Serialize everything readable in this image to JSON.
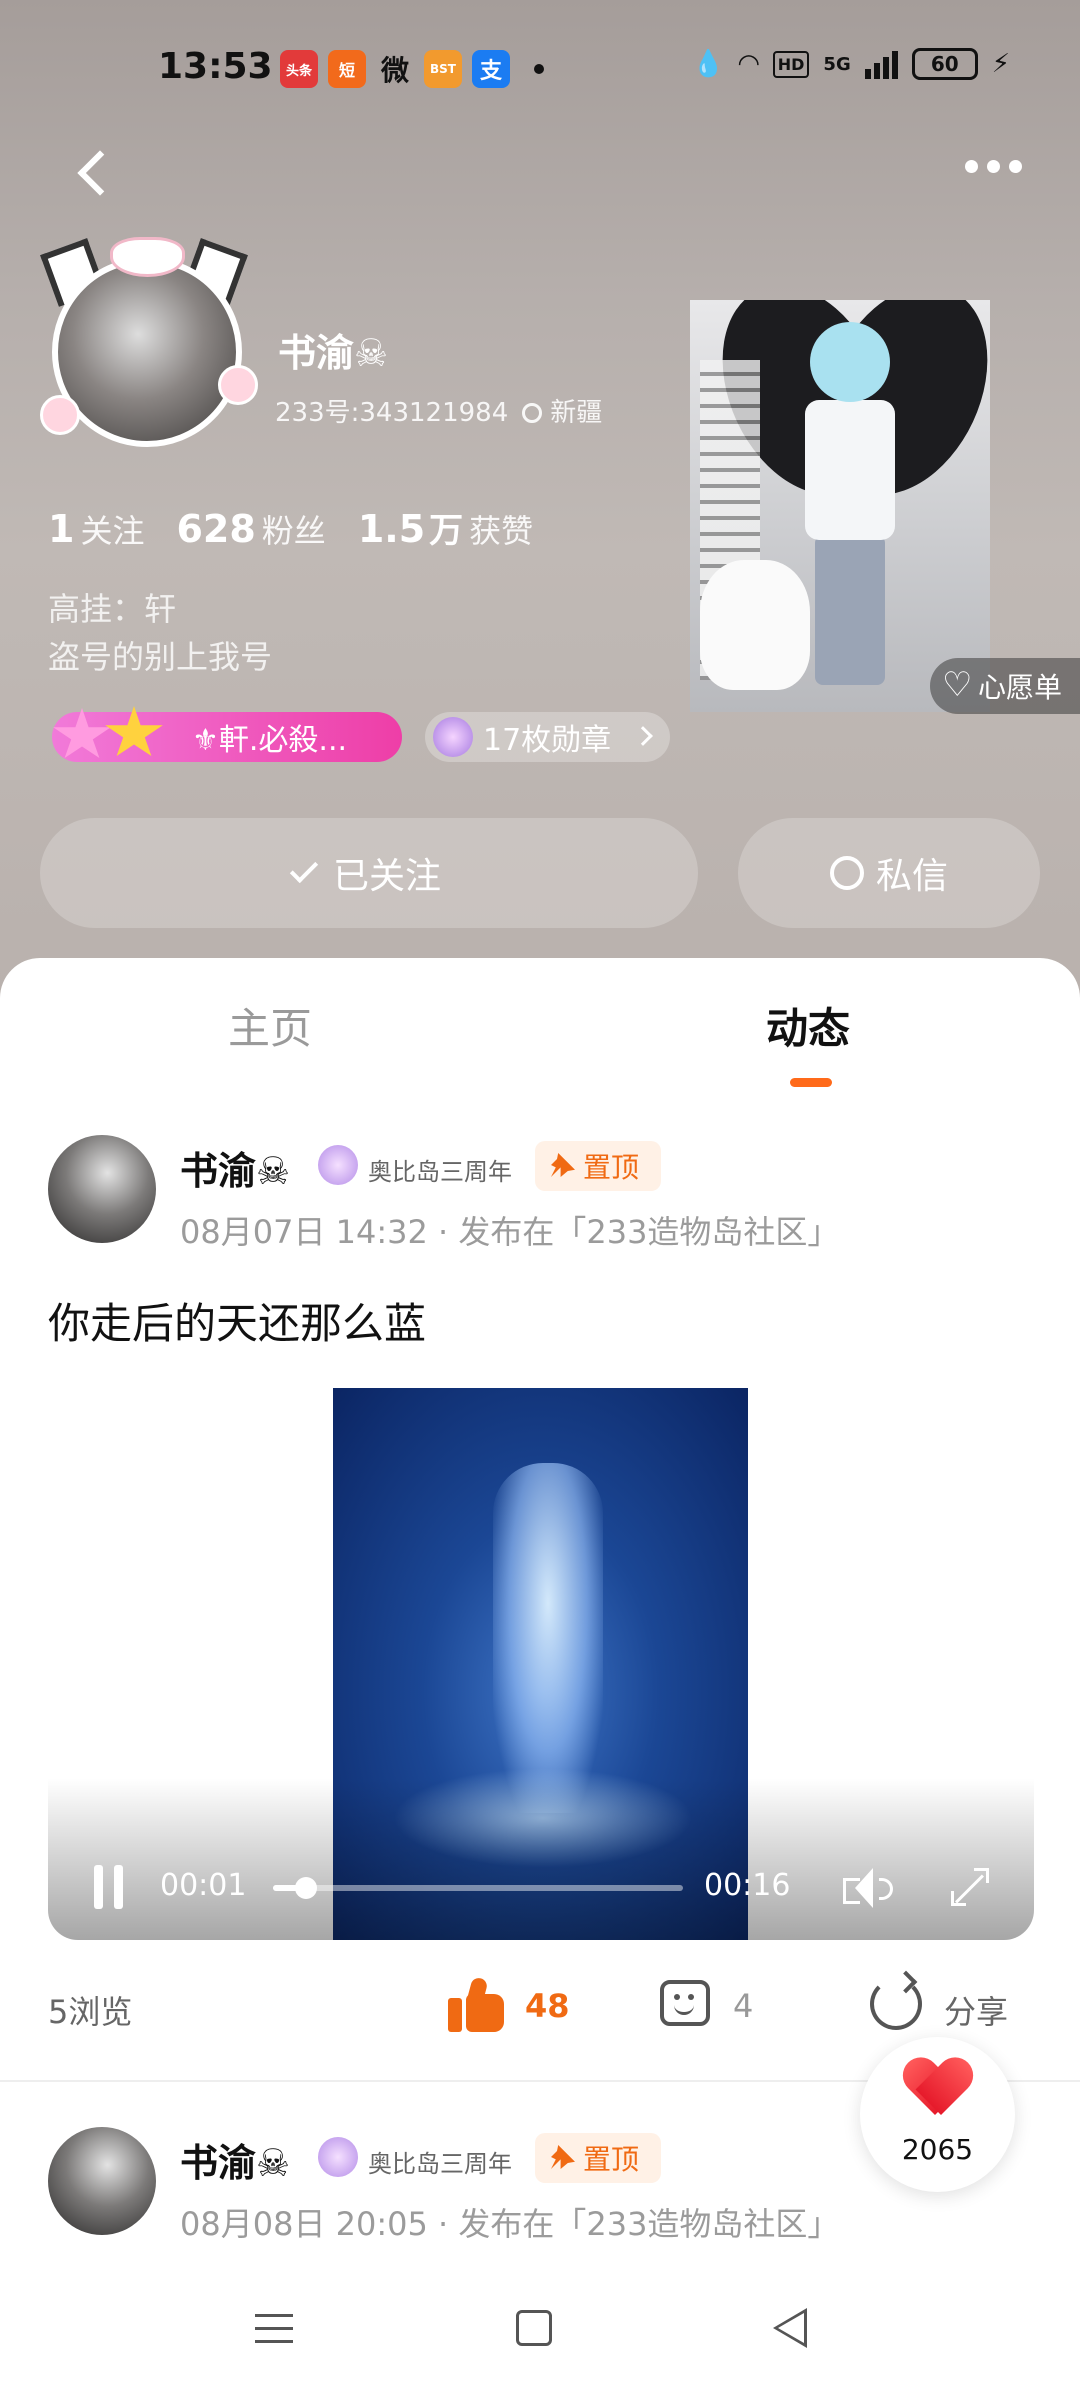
{
  "status_bar": {
    "time": "13:53",
    "notification_icons": [
      "头条",
      "短",
      "微",
      "BST",
      "支"
    ],
    "hd_label": "HD",
    "network_label": "5G",
    "battery_level": "60"
  },
  "profile": {
    "name": "书渝☠",
    "id_text": "233号:343121984",
    "location": "新疆",
    "stats": {
      "following_count": "1",
      "following_label": "关注",
      "followers_count": "628",
      "followers_label": "粉丝",
      "likes_count": "1.5",
      "likes_unit": "万",
      "likes_label": "获赞"
    },
    "bio_line1": "高挂：轩",
    "bio_line2": "盗号的别上我号",
    "title_badge": "⚜軒.必殺...",
    "medals_label": "17枚勋章",
    "follow_button": "已关注",
    "message_button": "私信",
    "wishlist_label": "心愿单"
  },
  "tabs": {
    "home": "主页",
    "feed": "动态"
  },
  "posts": [
    {
      "author": "书渝☠",
      "anniversary_badge": "奥比岛三周年",
      "pin_label": "置顶",
      "meta": "08月07日 14:32 · 发布在「233造物岛社区」",
      "text": "你走后的天还那么蓝",
      "video": {
        "current_time": "00:01",
        "total_time": "00:16",
        "progress": 0.0625
      },
      "views": "5浏览",
      "likes": "48",
      "comments": "4",
      "share_label": "分享"
    },
    {
      "author": "书渝☠",
      "anniversary_badge": "奥比岛三周年",
      "pin_label": "置顶",
      "meta": "08月08日 20:05 · 发布在「233造物岛社区」"
    }
  ],
  "floating_favorite": {
    "count": "2065"
  },
  "colors": {
    "accent": "#f06a13",
    "tab_indicator": "#ff6a1a",
    "badge_pink": "#ee3ea7",
    "heart_red": "#e61a2b"
  }
}
